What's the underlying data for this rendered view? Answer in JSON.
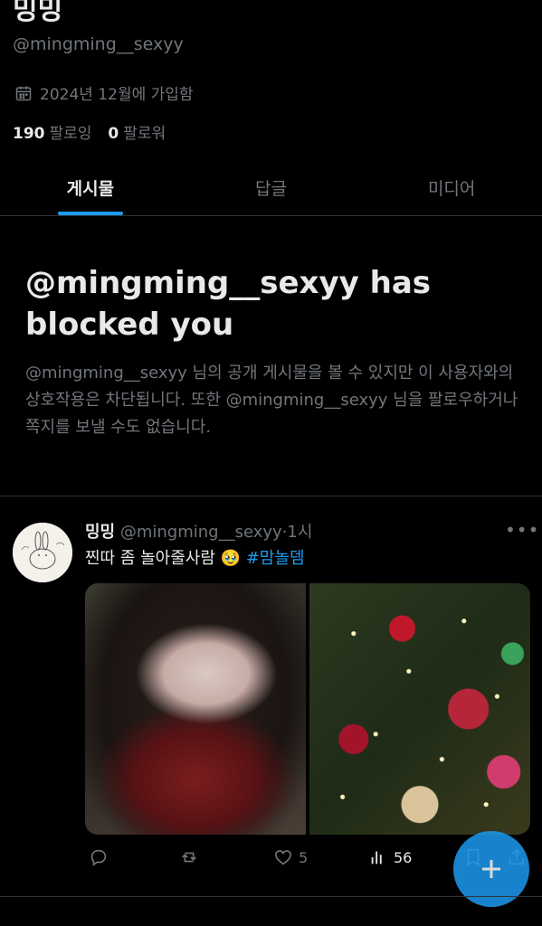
{
  "profile": {
    "name": "밍밍",
    "handle": "@mingming__sexyy",
    "joined": "2024년 12월에 가입함",
    "following_count": "190",
    "following_label": "팔로잉",
    "followers_count": "0",
    "followers_label": "팔로워"
  },
  "tabs": [
    {
      "label": "게시물",
      "active": true
    },
    {
      "label": "답글",
      "active": false
    },
    {
      "label": "미디어",
      "active": false
    }
  ],
  "blocked_notice": {
    "title": "@mingming__sexyy has blocked you",
    "description": "@mingming__sexyy 님의 공개 게시물을 볼 수 있지만 이 사용자와의 상호작용은 차단됩니다. 또한 @mingming__sexyy 님을 팔로우하거나 쪽지를 보낼 수도 없습니다."
  },
  "tweet": {
    "author_name": "밍밍",
    "author_handle": "@mingming__sexyy",
    "time": "·1시",
    "text": "찐따 좀 놀아줄사람",
    "emoji": "🥹",
    "hashtag": "#맘놀뎀",
    "actions": {
      "replies": "",
      "retweets": "",
      "likes": "5",
      "views": "56"
    }
  },
  "colors": {
    "background": "#000000",
    "text_primary": "#e7e9ea",
    "text_secondary": "#71767b",
    "accent": "#1d9bf0",
    "divider": "#2f3336"
  },
  "icons": [
    "calendar-icon",
    "more-icon",
    "reply-icon",
    "retweet-icon",
    "like-icon",
    "views-icon",
    "bookmark-icon",
    "share-icon",
    "compose-plus-icon"
  ]
}
